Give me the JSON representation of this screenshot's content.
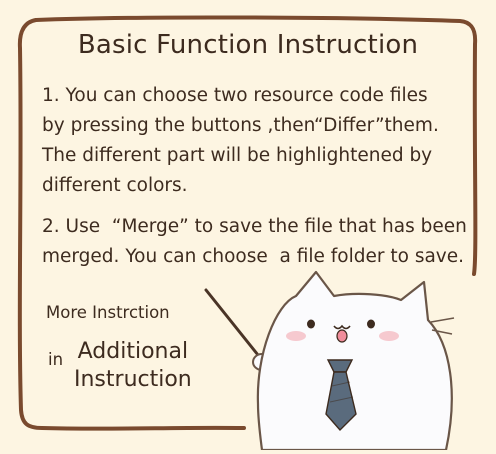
{
  "title": "Basic Function Instruction",
  "instructions": [
    "1. You can choose two resource code files\nby pressing the buttons ,then“Differ”them.\nThe different part will be highlightened by\ndifferent colors.",
    "2. Use  “Merge” to save the file that has been\nmerged. You can choose  a file folder to save."
  ],
  "more_label": "More Instrction",
  "in_label": "in",
  "additional_link": {
    "line1": "Additional",
    "line2": "Instruction"
  },
  "colors": {
    "background": "#fdf5e2",
    "border": "#7a4a2e",
    "text": "#3d2b1f",
    "tie": "#5a6b7d"
  },
  "illustration": "cat-with-tie-pointing"
}
